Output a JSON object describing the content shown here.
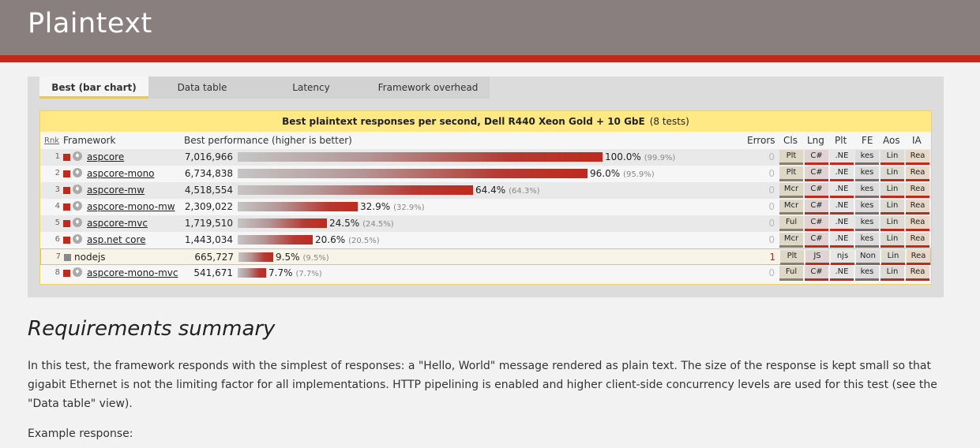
{
  "header": {
    "title": "Plaintext"
  },
  "tabs": [
    {
      "label": "Best (bar chart)"
    },
    {
      "label": "Data table"
    },
    {
      "label": "Latency"
    },
    {
      "label": "Framework overhead"
    }
  ],
  "chart": {
    "title": "Best plaintext responses per second, Dell R440 Xeon Gold + 10 GbE",
    "tests": "(8 tests)",
    "columns": {
      "rank": "Rnk",
      "framework": "Framework",
      "performance": "Best performance (higher is better)",
      "errors": "Errors",
      "cls": "Cls",
      "lng": "Lng",
      "plt": "Plt",
      "fe": "FE",
      "aos": "Aos",
      "ia": "IA"
    },
    "rows": [
      {
        "rank": "1",
        "name": "aspcore",
        "value": "7,016,966",
        "pct": "100.0%",
        "sub": "(99.9%)",
        "errors": "0",
        "cls": "Plt",
        "lng": "C#",
        "plt": ".NE",
        "fe": "kes",
        "aos": "Lin",
        "ia": "Rea"
      },
      {
        "rank": "2",
        "name": "aspcore-mono",
        "value": "6,734,838",
        "pct": "96.0%",
        "sub": "(95.9%)",
        "errors": "0",
        "cls": "Plt",
        "lng": "C#",
        "plt": ".NE",
        "fe": "kes",
        "aos": "Lin",
        "ia": "Rea"
      },
      {
        "rank": "3",
        "name": "aspcore-mw",
        "value": "4,518,554",
        "pct": "64.4%",
        "sub": "(64.3%)",
        "errors": "0",
        "cls": "Mcr",
        "lng": "C#",
        "plt": ".NE",
        "fe": "kes",
        "aos": "Lin",
        "ia": "Rea"
      },
      {
        "rank": "4",
        "name": "aspcore-mono-mw",
        "value": "2,309,022",
        "pct": "32.9%",
        "sub": "(32.9%)",
        "errors": "0",
        "cls": "Mcr",
        "lng": "C#",
        "plt": ".NE",
        "fe": "kes",
        "aos": "Lin",
        "ia": "Rea"
      },
      {
        "rank": "5",
        "name": "aspcore-mvc",
        "value": "1,719,510",
        "pct": "24.5%",
        "sub": "(24.5%)",
        "errors": "0",
        "cls": "Ful",
        "lng": "C#",
        "plt": ".NE",
        "fe": "kes",
        "aos": "Lin",
        "ia": "Rea"
      },
      {
        "rank": "6",
        "name": "asp.net core",
        "value": "1,443,034",
        "pct": "20.6%",
        "sub": "(20.5%)",
        "errors": "0",
        "cls": "Mcr",
        "lng": "C#",
        "plt": ".NE",
        "fe": "kes",
        "aos": "Lin",
        "ia": "Rea"
      },
      {
        "rank": "7",
        "name": "nodejs",
        "value": "665,727",
        "pct": "9.5%",
        "sub": "(9.5%)",
        "errors": "1",
        "cls": "Plt",
        "lng": "JS",
        "plt": "njs",
        "fe": "Non",
        "aos": "Lin",
        "ia": "Rea"
      },
      {
        "rank": "8",
        "name": "aspcore-mono-mvc",
        "value": "541,671",
        "pct": "7.7%",
        "sub": "(7.7%)",
        "errors": "0",
        "cls": "Ful",
        "lng": "C#",
        "plt": ".NE",
        "fe": "kes",
        "aos": "Lin",
        "ia": "Rea"
      }
    ]
  },
  "chart_data": {
    "type": "bar",
    "title": "Best plaintext responses per second, Dell R440 Xeon Gold + 10 GbE",
    "categories": [
      "aspcore",
      "aspcore-mono",
      "aspcore-mw",
      "aspcore-mono-mw",
      "aspcore-mvc",
      "asp.net core",
      "nodejs",
      "aspcore-mono-mvc"
    ],
    "values": [
      7016966,
      6734838,
      4518554,
      2309022,
      1719510,
      1443034,
      665727,
      541671
    ],
    "percent": [
      100.0,
      96.0,
      64.4,
      32.9,
      24.5,
      20.6,
      9.5,
      7.7
    ],
    "ylabel": "Best performance (higher is better)"
  },
  "requirements": {
    "title": "Requirements summary",
    "text": "In this test, the framework responds with the simplest of responses: a \"Hello, World\" message rendered as plain text. The size of the response is kept small so that gigabit Ethernet is not the limiting factor for all implementations. HTTP pipelining is enabled and higher client-side concurrency levels are used for this test (see the \"Data table\" view).",
    "example_label": "Example response:"
  },
  "colors": {
    "accent": "#c02a1d",
    "header": "#8a7f7f",
    "chart_title_bg": "#ffe985"
  }
}
